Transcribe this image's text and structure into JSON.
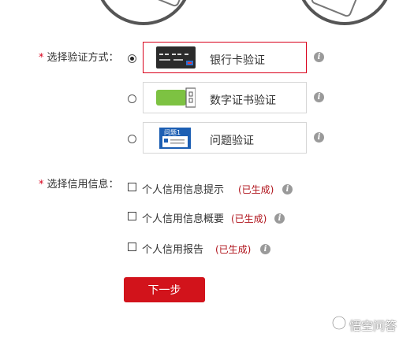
{
  "verification": {
    "label": "选择验证方式：",
    "required_mark": "*",
    "methods": [
      {
        "label": "银行卡验证",
        "selected": true,
        "icon": "bank-card-icon"
      },
      {
        "label": "数字证书验证",
        "selected": false,
        "icon": "digital-certificate-icon"
      },
      {
        "label": "问题验证",
        "selected": false,
        "icon": "question-document-icon",
        "icon_text": "问题1"
      }
    ]
  },
  "credit_info": {
    "label": "选择信用信息：",
    "required_mark": "*",
    "options": [
      {
        "label": "个人信用信息提示",
        "status": "(已生成)"
      },
      {
        "label": "个人信用信息概要",
        "status": "(已生成)"
      },
      {
        "label": "个人信用报告",
        "status": "(已生成)"
      }
    ]
  },
  "next_button": {
    "label": "下一步"
  },
  "watermark": {
    "text": "悟空问答"
  },
  "colors": {
    "accent": "#d2131b",
    "status_text": "#b0141c",
    "selected_border": "#d9001b"
  }
}
